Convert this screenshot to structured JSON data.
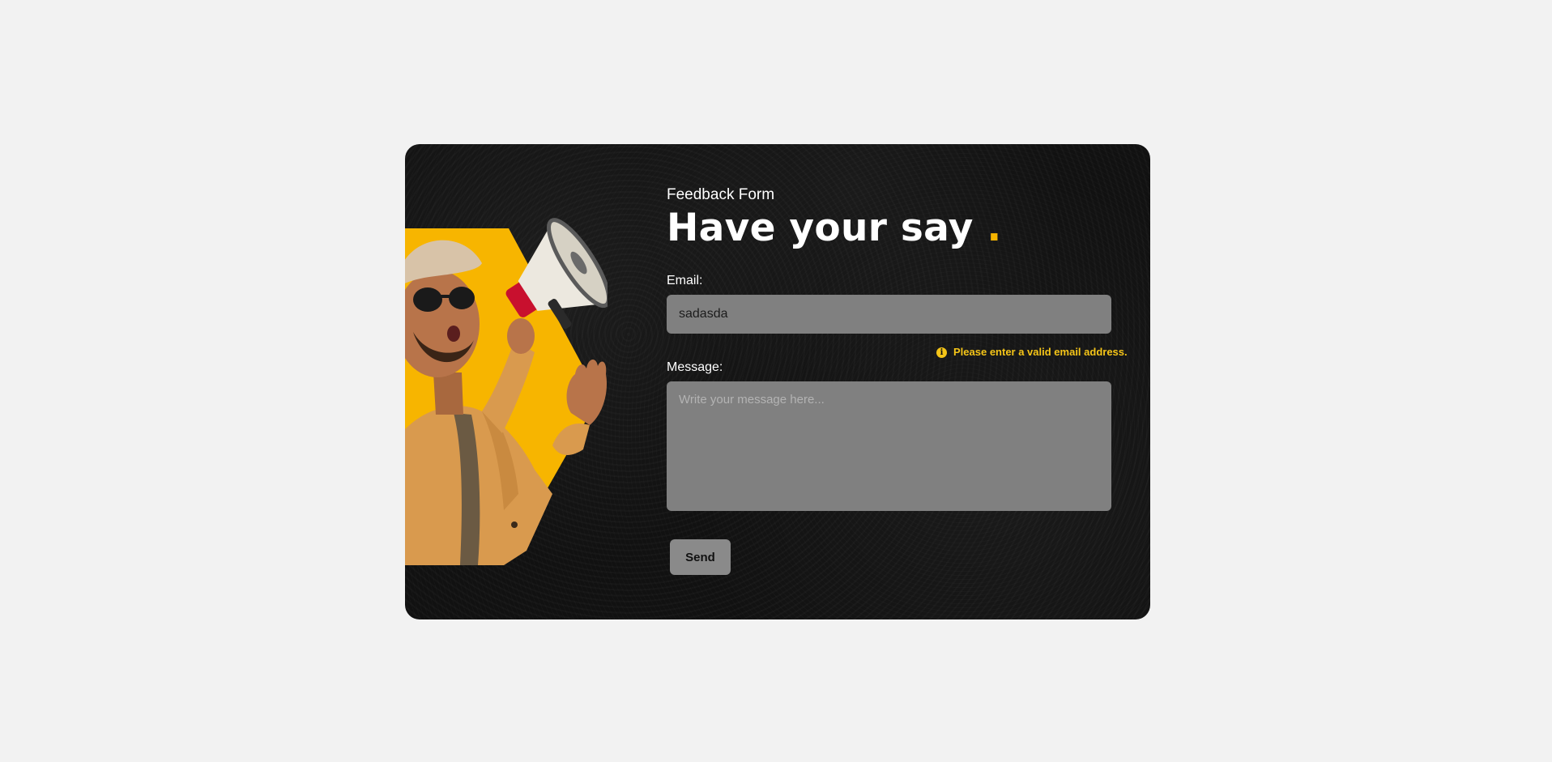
{
  "form": {
    "eyebrow": "Feedback Form",
    "headline": "Have your say",
    "headline_dot": ".",
    "email_label": "Email:",
    "email_value": "sadasda",
    "email_error": "Please enter a valid email address.",
    "message_label": "Message:",
    "message_placeholder": "Write your message here...",
    "send_label": "Send"
  },
  "icons": {
    "error": "info-circle-icon",
    "hero": "megaphone-person-illustration"
  },
  "colors": {
    "accent": "#f5b400",
    "error": "#f5c518",
    "card_background": "#111111",
    "field_background": "#808080",
    "page_background": "#f2f2f2"
  }
}
